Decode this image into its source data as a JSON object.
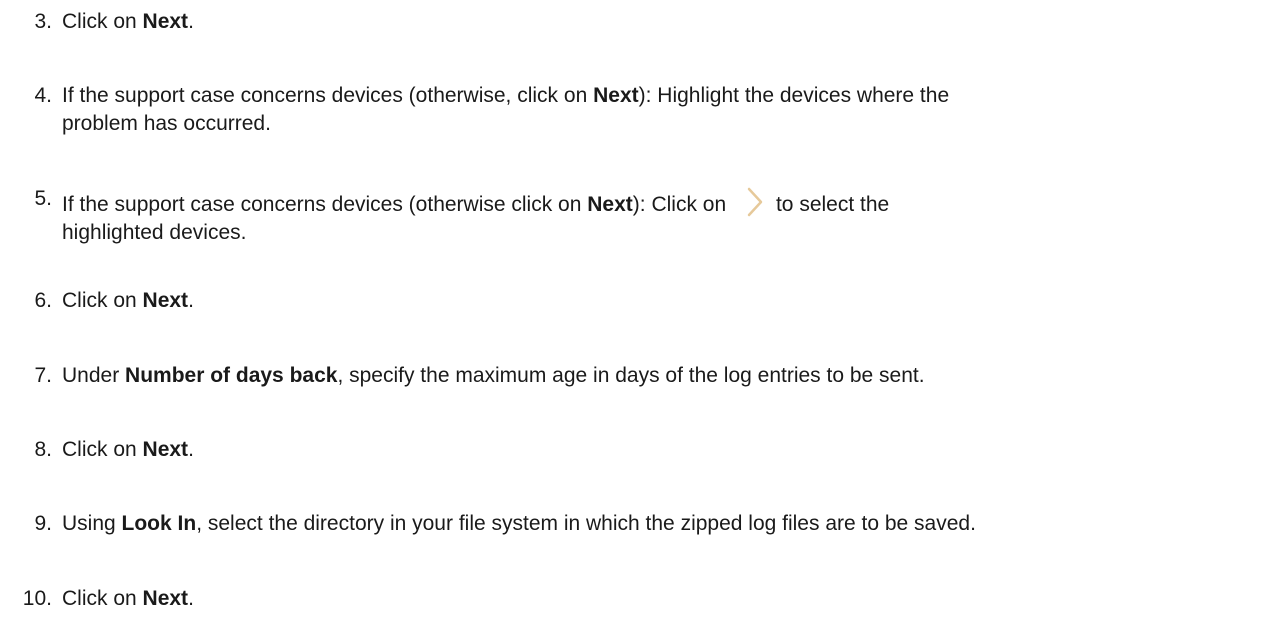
{
  "steps": [
    {
      "num": "3.",
      "parts": [
        "Click on ",
        "Next",
        "."
      ]
    },
    {
      "num": "4.",
      "parts": [
        "If the support case concerns devices (otherwise, click on ",
        "Next",
        "): Highlight the devices where the",
        "problem has occurred."
      ]
    },
    {
      "num": "5.",
      "parts": [
        "If the support case concerns devices (otherwise click on ",
        "Next",
        "): Click on ",
        "to select the",
        "highlighted devices."
      ]
    },
    {
      "num": "6.",
      "parts": [
        "Click on ",
        "Next",
        "."
      ]
    },
    {
      "num": "7.",
      "parts": [
        "Under ",
        "Number of days back",
        ", specify the maximum age in days of the log entries to be sent."
      ]
    },
    {
      "num": "8.",
      "parts": [
        "Click on ",
        "Next",
        "."
      ]
    },
    {
      "num": "9.",
      "parts": [
        "Using ",
        "Look In",
        ", select the directory in your file system in which the zipped log files are to be saved."
      ]
    },
    {
      "num": "10.",
      "parts": [
        "Click on ",
        "Next",
        "."
      ]
    }
  ],
  "icons": {
    "select_arrow": "chevron-right-icon",
    "select_arrow_color": "#e6c99a"
  }
}
